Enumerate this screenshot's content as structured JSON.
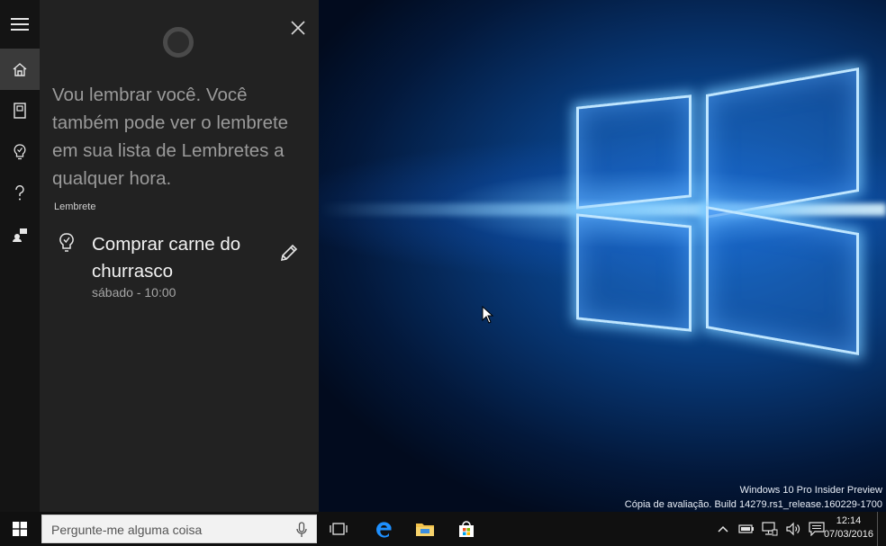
{
  "cortana": {
    "message": "Vou lembrar você. Você também pode ver o lembrete em sua lista de Lembretes a qualquer hora.",
    "section_label": "Lembrete",
    "reminder": {
      "title": "Comprar carne do churrasco",
      "time": "sábado - 10:00"
    }
  },
  "taskbar": {
    "search_placeholder": "Pergunte-me alguma coisa",
    "clock_time": "12:14",
    "clock_date": "07/03/2016"
  },
  "desktop": {
    "watermark_line1": "Windows 10 Pro Insider Preview",
    "watermark_line2": "Cópia de avaliação. Build 14279.rs1_release.160229-1700"
  },
  "icons": {
    "rail": [
      "hamburger-icon",
      "home-icon",
      "notebook-icon",
      "lightbulb-icon",
      "question-icon",
      "feedback-icon"
    ],
    "taskbar": [
      "windows-logo-icon",
      "microphone-icon",
      "task-view-icon",
      "edge-icon",
      "file-explorer-icon",
      "store-icon"
    ],
    "tray": [
      "chevron-up-icon",
      "battery-icon",
      "network-icon",
      "volume-icon",
      "action-center-icon"
    ]
  },
  "colors": {
    "cortana_panel": "#222222",
    "cortana_rail": "#141414",
    "taskbar": "#101010",
    "accent_blue": "#1e90ff"
  }
}
